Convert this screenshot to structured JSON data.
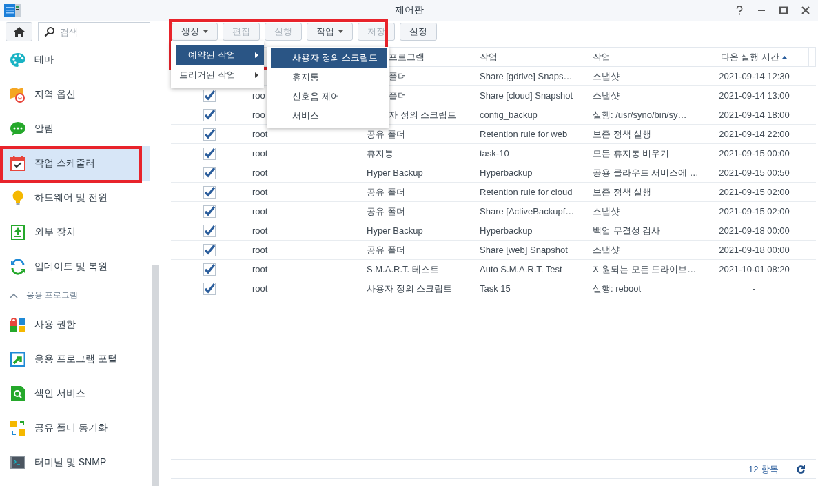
{
  "window": {
    "title": "제어판"
  },
  "sidebar": {
    "search": {
      "placeholder": "검색"
    },
    "items": [
      {
        "kind": "item",
        "label": "테마",
        "selected": false
      },
      {
        "kind": "item",
        "label": "지역 옵션",
        "selected": false
      },
      {
        "kind": "item",
        "label": "알림",
        "selected": false
      },
      {
        "kind": "item",
        "label": "작업 스케줄러",
        "selected": true,
        "callout": true
      },
      {
        "kind": "item",
        "label": "하드웨어 및 전원",
        "selected": false
      },
      {
        "kind": "item",
        "label": "외부 장치",
        "selected": false
      },
      {
        "kind": "item",
        "label": "업데이트 및 복원",
        "selected": false
      },
      {
        "kind": "section",
        "label": "응용 프로그램",
        "expanded": true
      },
      {
        "kind": "item",
        "label": "사용 권한",
        "selected": false
      },
      {
        "kind": "item",
        "label": "응용 프로그램 포털",
        "selected": false
      },
      {
        "kind": "item",
        "label": "색인 서비스",
        "selected": false
      },
      {
        "kind": "item",
        "label": "공유 폴더 동기화",
        "selected": false
      },
      {
        "kind": "item",
        "label": "터미널 및 SNMP",
        "selected": false
      }
    ]
  },
  "toolbar": {
    "callout": true,
    "buttons": [
      {
        "label": "생성",
        "dropdown": true,
        "disabled": false
      },
      {
        "label": "편집",
        "dropdown": false,
        "disabled": true
      },
      {
        "label": "실행",
        "dropdown": false,
        "disabled": true
      },
      {
        "label": "작업",
        "dropdown": true,
        "disabled": false
      },
      {
        "label": "저장",
        "dropdown": false,
        "disabled": true
      },
      {
        "label": "설정",
        "dropdown": false,
        "disabled": false
      }
    ]
  },
  "menu": {
    "items": [
      {
        "label": "예약된 작업",
        "selected": true
      },
      {
        "label": "트리거된 작업",
        "selected": false
      }
    ]
  },
  "submenu": {
    "items": [
      {
        "label": "사용자 정의 스크립트",
        "selected": true
      },
      {
        "label": "휴지통",
        "selected": false
      },
      {
        "label": "신호음 제어",
        "selected": false
      },
      {
        "label": "서비스",
        "selected": false
      }
    ]
  },
  "table": {
    "columns": [
      {
        "label": "프로그램",
        "cut": true
      },
      {
        "label": "작업"
      },
      {
        "label": "작업"
      },
      {
        "label": "다음 실행 시간",
        "sorted": true,
        "ascending": true
      }
    ],
    "rows": [
      {
        "app": "폴더",
        "app_cut": true,
        "task": "Share [gdrive] Snaps…",
        "action": "스냅샷",
        "next_run": "2021-09-14 12:30"
      },
      {
        "checked": true,
        "user": "roo",
        "app": "폴더",
        "app_cut": true,
        "task": "Share [cloud] Snapshot",
        "action": "스냅샷",
        "next_run": "2021-09-14 13:00"
      },
      {
        "checked": true,
        "user": "roo",
        "app": "자 정의 스크립트",
        "app_cut": true,
        "task": "config_backup",
        "action": "실행: /usr/syno/bin/sy…",
        "next_run": "2021-09-14 18:00"
      },
      {
        "checked": true,
        "user": "root",
        "app": "공유 폴더",
        "task": "Retention rule for web",
        "action": "보존 정책 실행",
        "next_run": "2021-09-14 22:00"
      },
      {
        "checked": true,
        "user": "root",
        "app": "휴지통",
        "task": "task-10",
        "action": "모든 휴지통 비우기",
        "next_run": "2021-09-15 00:00"
      },
      {
        "checked": true,
        "user": "root",
        "app": "Hyper Backup",
        "task": "Hyperbackup",
        "action": "공용 클라우드 서비스에 …",
        "next_run": "2021-09-15 00:50"
      },
      {
        "checked": true,
        "user": "root",
        "app": "공유 폴더",
        "task": "Retention rule for cloud",
        "action": "보존 정책 실행",
        "next_run": "2021-09-15 02:00"
      },
      {
        "checked": true,
        "user": "root",
        "app": "공유 폴더",
        "task": "Share [ActiveBackupf…",
        "action": "스냅샷",
        "next_run": "2021-09-15 02:00"
      },
      {
        "checked": true,
        "user": "root",
        "app": "Hyper Backup",
        "task": "Hyperbackup",
        "action": "백업 무결성 검사",
        "next_run": "2021-09-18 00:00"
      },
      {
        "checked": true,
        "user": "root",
        "app": "공유 폴더",
        "task": "Share [web] Snapshot",
        "action": "스냅샷",
        "next_run": "2021-09-18 00:00"
      },
      {
        "checked": true,
        "user": "root",
        "app": "S.M.A.R.T. 테스트",
        "task": "Auto S.M.A.R.T. Test",
        "action": "지원되는 모든 드라이브…",
        "next_run": "2021-10-01 08:20"
      },
      {
        "checked": true,
        "user": "root",
        "app": "사용자 정의 스크립트",
        "task": "Task 15",
        "action": "실행: reboot",
        "next_run": "-"
      }
    ]
  },
  "footer": {
    "count": "12 항목"
  }
}
